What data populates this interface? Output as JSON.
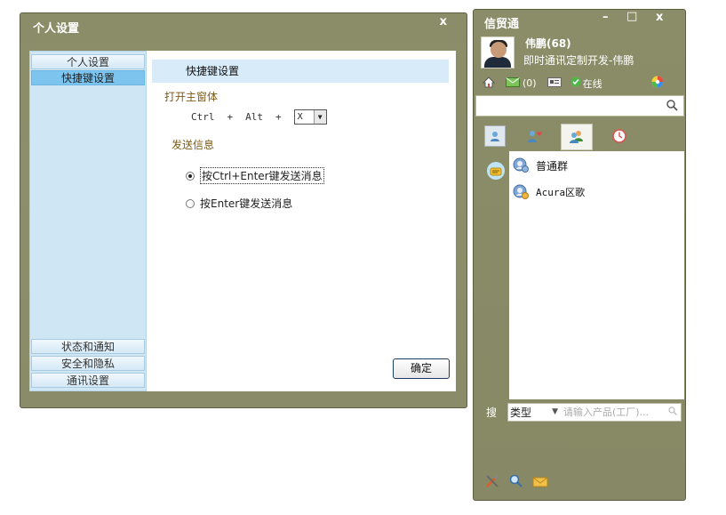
{
  "settings": {
    "title": "个人设置",
    "close": "x",
    "nav": {
      "items": [
        "个人设置",
        "快捷键设置"
      ],
      "bottom_items": [
        "状态和通知",
        "安全和隐私",
        "通讯设置"
      ]
    },
    "content": {
      "header": "快捷键设置",
      "open_main_label": "打开主窗体",
      "ctrl": "Ctrl",
      "plus": "+",
      "alt": "Alt",
      "key_value": "X",
      "send_label": "发送信息",
      "option1": "按Ctrl+Enter键发送消息",
      "option2": "按Enter键发送消息",
      "ok": "确定"
    }
  },
  "im": {
    "title": "信贸通",
    "minimize": "–",
    "maximize": "□",
    "close": "x",
    "user_name": "伟鹏(68)",
    "signature": "即时通讯定制开发-伟鹏",
    "mail_count": "(0)",
    "status": "在线",
    "groups": [
      "普通群",
      "Acura区歌"
    ],
    "search_label": "搜",
    "type_label": "类型",
    "search_placeholder": "请输入产品(工厂)..."
  },
  "colors": {
    "frame": "#8b8d68",
    "nav_bg": "#cfe6f5",
    "nav_active": "#7dc4ee",
    "header_bg": "#d8ebf8",
    "section_title": "#7a5a16"
  }
}
